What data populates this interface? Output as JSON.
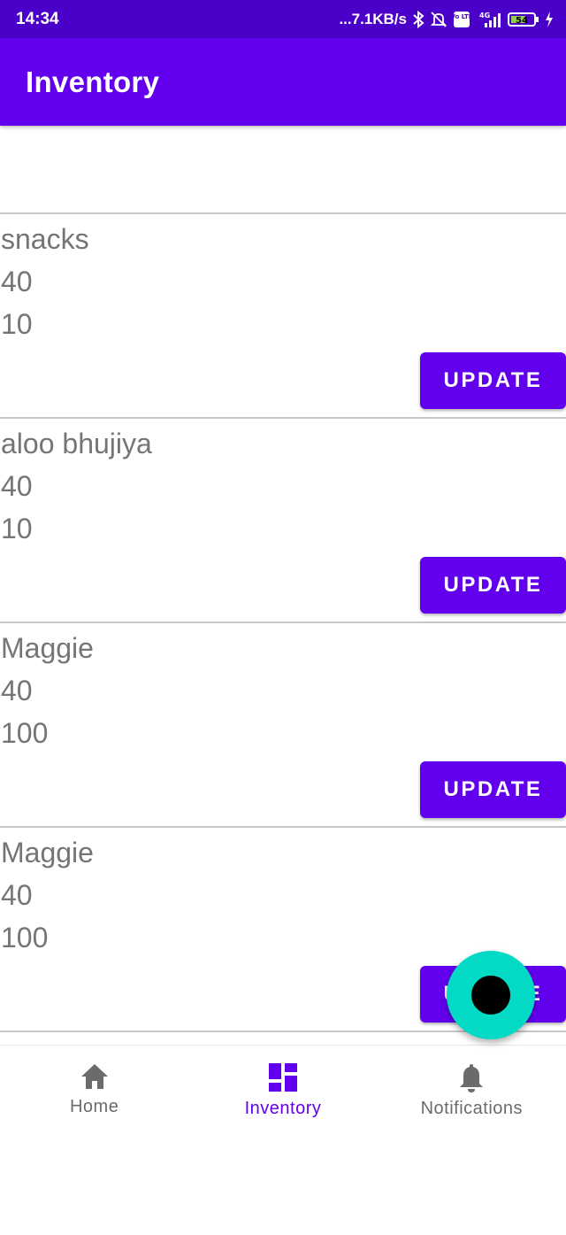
{
  "status_bar": {
    "time": "14:34",
    "network_speed": "...7.1KB/s",
    "network_type": "4G",
    "volte": "Vo LTE",
    "battery": "54"
  },
  "app_bar": {
    "title": "Inventory"
  },
  "items": [
    {
      "name": "snacks",
      "value1": "40",
      "value2": "10",
      "button": "UPDATE"
    },
    {
      "name": "aloo bhujiya",
      "value1": "40",
      "value2": "10",
      "button": "UPDATE"
    },
    {
      "name": "Maggie",
      "value1": "40",
      "value2": "100",
      "button": "UPDATE"
    },
    {
      "name": "Maggie",
      "value1": "40",
      "value2": "100",
      "button": "UPDATE"
    }
  ],
  "bottom_nav": [
    {
      "label": "Home",
      "icon": "home-icon",
      "active": false
    },
    {
      "label": "Inventory",
      "icon": "dashboard-icon",
      "active": true
    },
    {
      "label": "Notifications",
      "icon": "bell-icon",
      "active": false
    }
  ],
  "colors": {
    "primary": "#6200ee",
    "status_bar": "#4a00c9",
    "fab": "#03dac5",
    "text_secondary": "#757575"
  }
}
